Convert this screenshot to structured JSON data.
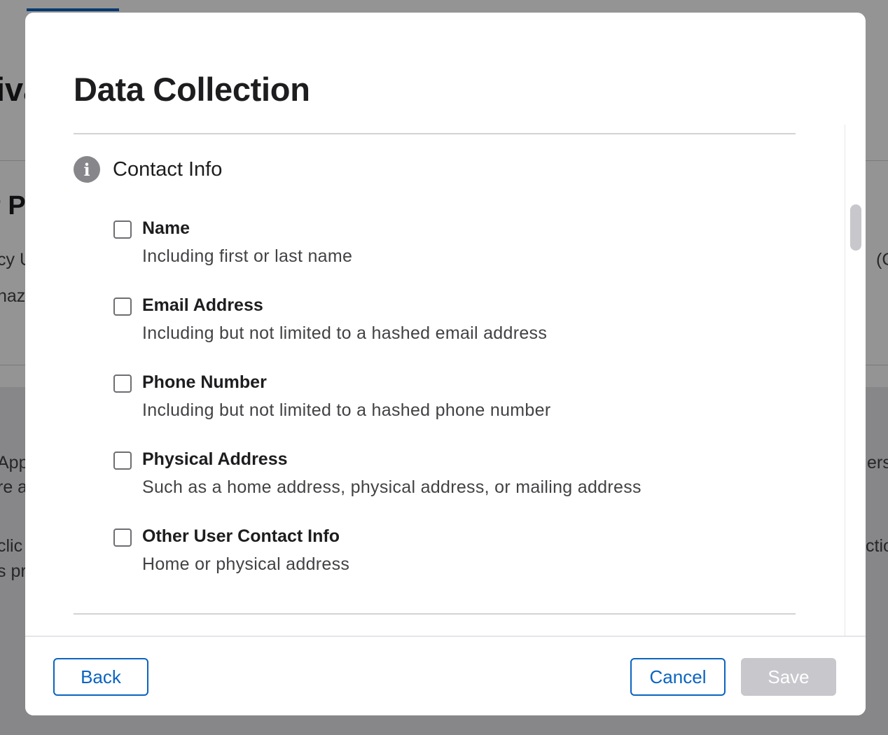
{
  "background": {
    "fragments": [
      "iva",
      "r P",
      "cy U",
      "naz",
      "App",
      "re a",
      "clic",
      "s pr",
      "(C",
      "ers",
      "ctio"
    ]
  },
  "modal": {
    "title": "Data Collection",
    "section": {
      "icon": "info-icon",
      "title": "Contact Info"
    },
    "options": [
      {
        "label": "Name",
        "description": "Including first or last name",
        "checked": false
      },
      {
        "label": "Email Address",
        "description": "Including but not limited to a hashed email address",
        "checked": false
      },
      {
        "label": "Phone Number",
        "description": "Including but not limited to a hashed phone number",
        "checked": false
      },
      {
        "label": "Physical Address",
        "description": "Such as a home address, physical address, or mailing address",
        "checked": false
      },
      {
        "label": "Other User Contact Info",
        "description": "Home or physical address",
        "checked": false
      }
    ],
    "footer": {
      "back_label": "Back",
      "cancel_label": "Cancel",
      "save_label": "Save",
      "save_disabled": true
    }
  },
  "colors": {
    "accent": "#0b64c0",
    "disabled": "#c7c7cc",
    "overlay": "rgba(0,0,0,0.42)"
  }
}
